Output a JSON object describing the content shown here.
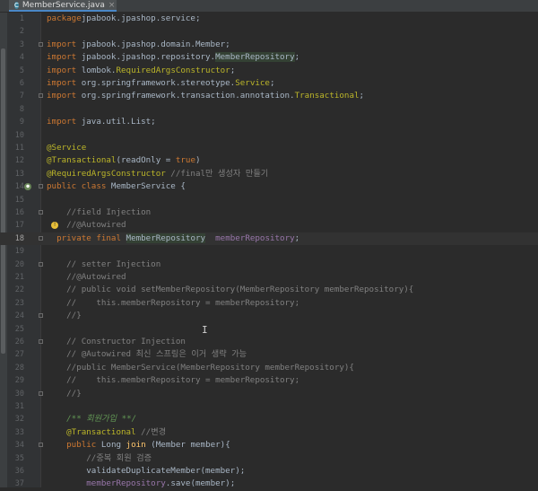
{
  "tab": {
    "filename": "MemberService.java",
    "icon": "c-class-icon",
    "close": "×"
  },
  "lines": [
    {
      "n": "1",
      "t": [
        [
          "kw",
          "package"
        ],
        [
          "",
          "jpabook.jpashop.service;"
        ]
      ]
    },
    {
      "n": "2",
      "t": []
    },
    {
      "n": "3",
      "t": [
        [
          "kw",
          "import"
        ],
        [
          "",
          " jpabook.jpashop.domain.Member;"
        ]
      ]
    },
    {
      "n": "4",
      "t": [
        [
          "kw",
          "import"
        ],
        [
          "",
          " jpabook.jpashop.repository."
        ],
        [
          "hl",
          "MemberRepository"
        ],
        [
          "",
          ";"
        ]
      ]
    },
    {
      "n": "5",
      "t": [
        [
          "kw",
          "import"
        ],
        [
          "",
          " lombok."
        ],
        [
          "an",
          "RequiredArgsConstructor"
        ],
        [
          "",
          ";"
        ]
      ]
    },
    {
      "n": "6",
      "t": [
        [
          "kw",
          "import"
        ],
        [
          "",
          " org.springframework.stereotype."
        ],
        [
          "an",
          "Service"
        ],
        [
          "",
          ";"
        ]
      ]
    },
    {
      "n": "7",
      "t": [
        [
          "kw",
          "import"
        ],
        [
          "",
          " org.springframework.transaction.annotation."
        ],
        [
          "an",
          "Transactional"
        ],
        [
          "",
          ";"
        ]
      ]
    },
    {
      "n": "8",
      "t": []
    },
    {
      "n": "9",
      "t": [
        [
          "kw",
          "import"
        ],
        [
          "",
          " java.util.List;"
        ]
      ]
    },
    {
      "n": "10",
      "t": []
    },
    {
      "n": "11",
      "t": [
        [
          "an",
          "@Service"
        ]
      ]
    },
    {
      "n": "12",
      "t": [
        [
          "an",
          "@Transactional"
        ],
        [
          "",
          "(readOnly = "
        ],
        [
          "kw",
          "true"
        ],
        [
          "",
          ")"
        ]
      ]
    },
    {
      "n": "13",
      "t": [
        [
          "an",
          "@RequiredArgsConstructor"
        ],
        [
          "cm",
          " //final만 생성자 만들기"
        ]
      ]
    },
    {
      "n": "14",
      "t": [
        [
          "kw",
          "public class"
        ],
        [
          "",
          " MemberService {"
        ]
      ]
    },
    {
      "n": "15",
      "t": []
    },
    {
      "n": "16",
      "t": [
        [
          "cm",
          "    //field Injection"
        ]
      ]
    },
    {
      "n": "17",
      "t": [
        [
          "cm",
          "    //@Autowired"
        ]
      ]
    },
    {
      "n": "18",
      "t": [
        [
          "",
          "  "
        ],
        [
          "kw",
          "private final"
        ],
        [
          "",
          " "
        ],
        [
          "hl",
          "MemberRepository"
        ],
        [
          "",
          " "
        ],
        [
          "fd",
          " memberRepository"
        ],
        [
          "",
          ";"
        ]
      ]
    },
    {
      "n": "19",
      "t": []
    },
    {
      "n": "20",
      "t": [
        [
          "cm",
          "    // setter Injection"
        ]
      ]
    },
    {
      "n": "21",
      "t": [
        [
          "cm",
          "    //@Autowired"
        ]
      ]
    },
    {
      "n": "22",
      "t": [
        [
          "cm",
          "    // public void setMemberRepository(MemberRepository memberRepository){"
        ]
      ]
    },
    {
      "n": "23",
      "t": [
        [
          "cm",
          "    //    this.memberRepository = memberRepository;"
        ]
      ]
    },
    {
      "n": "24",
      "t": [
        [
          "cm",
          "    //}"
        ]
      ]
    },
    {
      "n": "25",
      "t": []
    },
    {
      "n": "26",
      "t": [
        [
          "cm",
          "    // Constructor Injection"
        ]
      ]
    },
    {
      "n": "27",
      "t": [
        [
          "cm",
          "    // @Autowired 최신 스프링은 이거 생략 가능"
        ]
      ]
    },
    {
      "n": "28",
      "t": [
        [
          "cm",
          "    //public MemberService(MemberRepository memberRepository){"
        ]
      ]
    },
    {
      "n": "29",
      "t": [
        [
          "cm",
          "    //    this.memberRepository = memberRepository;"
        ]
      ]
    },
    {
      "n": "30",
      "t": [
        [
          "cm",
          "    //}"
        ]
      ]
    },
    {
      "n": "31",
      "t": []
    },
    {
      "n": "32",
      "t": [
        [
          "dc",
          "    /** 회원가입 **/"
        ]
      ]
    },
    {
      "n": "33",
      "t": [
        [
          "",
          "    "
        ],
        [
          "an",
          "@Transactional"
        ],
        [
          "cm",
          " //변경"
        ]
      ]
    },
    {
      "n": "34",
      "t": [
        [
          "",
          "    "
        ],
        [
          "kw",
          "public"
        ],
        [
          "",
          " Long "
        ],
        [
          "fn",
          "join"
        ],
        [
          "",
          " (Member member){"
        ]
      ]
    },
    {
      "n": "35",
      "t": [
        [
          "cm",
          "        //중복 회원 검증"
        ]
      ]
    },
    {
      "n": "36",
      "t": [
        [
          "",
          "        validateDuplicateMember(member);"
        ]
      ]
    },
    {
      "n": "37",
      "t": [
        [
          "",
          "        "
        ],
        [
          "fd",
          "memberRepository"
        ],
        [
          "",
          ".save(member);"
        ]
      ]
    }
  ],
  "current_line": "18",
  "cursor_glyph": "I"
}
